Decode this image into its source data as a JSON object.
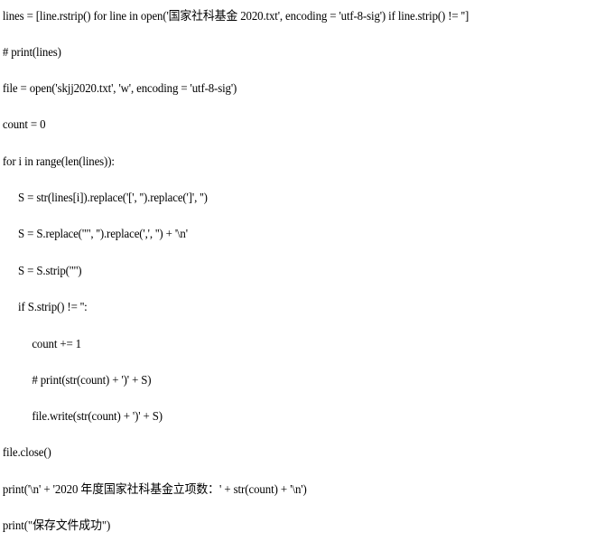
{
  "document": {
    "type": "python-source-listing",
    "background_color": "#ffffff",
    "text_color": "#000000",
    "lines": [
      {
        "id": "line-1",
        "indent": 0,
        "text": "lines = [line.rstrip() for line in open('国家社科基金 2020.txt', encoding = 'utf-8-sig') if line.strip() != '']"
      },
      {
        "id": "line-2",
        "indent": 0,
        "text": "# print(lines)"
      },
      {
        "id": "line-3",
        "indent": 0,
        "text": "file = open('skjj2020.txt', 'w', encoding = 'utf-8-sig')"
      },
      {
        "id": "line-4",
        "indent": 0,
        "text": "count = 0"
      },
      {
        "id": "line-5",
        "indent": 0,
        "text": "for i in range(len(lines)):"
      },
      {
        "id": "line-6",
        "indent": 1,
        "text": "S = str(lines[i]).replace('[', '').replace(']', '')"
      },
      {
        "id": "line-7",
        "indent": 1,
        "text": "S = S.replace('\"', '').replace(',', '') + '\\n'"
      },
      {
        "id": "line-8",
        "indent": 1,
        "text": "S = S.strip('\"')"
      },
      {
        "id": "line-9",
        "indent": 1,
        "text": "if S.strip() != '':"
      },
      {
        "id": "line-10",
        "indent": 2,
        "text": "count += 1"
      },
      {
        "id": "line-11",
        "indent": 2,
        "text": "# print(str(count) + ')' + S)"
      },
      {
        "id": "line-12",
        "indent": 2,
        "text": "file.write(str(count) + ')' + S)"
      },
      {
        "id": "line-13",
        "indent": 0,
        "text": "file.close()"
      },
      {
        "id": "line-14",
        "indent": 0,
        "text": "print('\\n' + '2020 年度国家社科基金立项数：' + str(count) + '\\n')"
      },
      {
        "id": "line-15",
        "indent": 0,
        "text": "print(\"保存文件成功\")"
      }
    ]
  }
}
